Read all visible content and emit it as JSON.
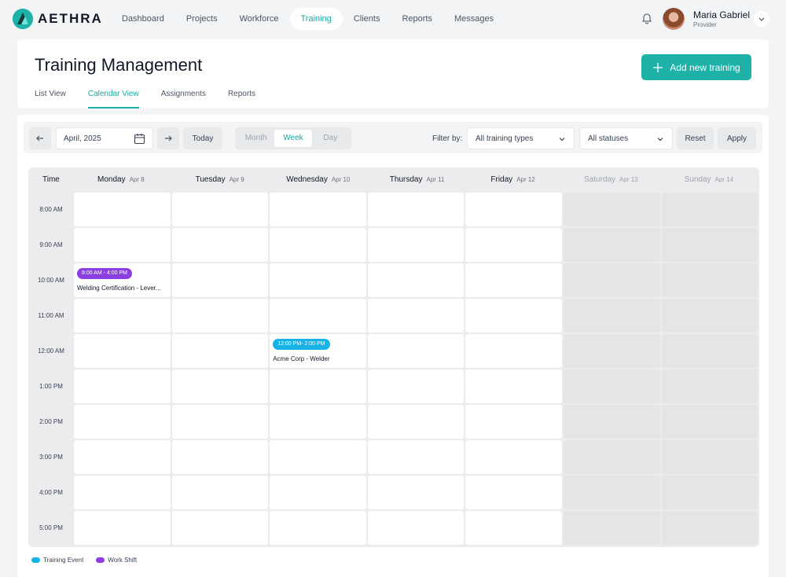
{
  "brand": {
    "name": "AETHRA",
    "accent": "#1db1a7"
  },
  "nav": {
    "items": [
      {
        "label": "Dashboard",
        "active": false
      },
      {
        "label": "Projects",
        "active": false
      },
      {
        "label": "Workforce",
        "active": false
      },
      {
        "label": "Training",
        "active": true
      },
      {
        "label": "Clients",
        "active": false
      },
      {
        "label": "Reports",
        "active": false
      },
      {
        "label": "Messages",
        "active": false
      }
    ],
    "icons": {
      "notifications": "bell-icon",
      "menu": "chevron-down-icon"
    }
  },
  "user": {
    "name": "Maria Gabriel",
    "role": "Provider"
  },
  "header": {
    "title": "Training Management",
    "add_button": "Add new training",
    "tabs": [
      {
        "label": "List View",
        "active": false
      },
      {
        "label": "Calendar View",
        "active": true
      },
      {
        "label": "Assignments",
        "active": false
      },
      {
        "label": "Reports",
        "active": false
      }
    ]
  },
  "toolbar": {
    "date_value": "April, 2025",
    "today": "Today",
    "views": [
      {
        "label": "Month",
        "active": false
      },
      {
        "label": "Week",
        "active": true
      },
      {
        "label": "Day",
        "active": false
      }
    ],
    "filter_label": "Filter by:",
    "type_filter": "All training types",
    "status_filter": "All statuses",
    "reset": "Reset",
    "apply": "Apply"
  },
  "calendar": {
    "time_header": "Time",
    "days": [
      {
        "name": "Monday",
        "date": "Apr 8",
        "weekend": false
      },
      {
        "name": "Tuesday",
        "date": "Apr 9",
        "weekend": false
      },
      {
        "name": "Wednesday",
        "date": "Apr 10",
        "weekend": false
      },
      {
        "name": "Thursday",
        "date": "Apr 11",
        "weekend": false
      },
      {
        "name": "Friday",
        "date": "Apr 12",
        "weekend": false
      },
      {
        "name": "Saturday",
        "date": "Apr 13",
        "weekend": true
      },
      {
        "name": "Sunday",
        "date": "Apr 14",
        "weekend": true
      }
    ],
    "times": [
      "8:00 AM",
      "9:00 AM",
      "10:00 AM",
      "11:00 AM",
      "12:00 AM",
      "1:00 PM",
      "2:00 PM",
      "3:00 PM",
      "4:00 PM",
      "5:00 PM"
    ],
    "events": [
      {
        "day": 0,
        "slot": 2,
        "time": "8:00 AM - 4:00 PM",
        "title": "Welding Certification - Lever...",
        "kind": "Work Shift",
        "color": "#8b3fe0"
      },
      {
        "day": 2,
        "slot": 4,
        "time": "12:00 PM- 2:00 PM",
        "title": "Acme Corp - Welder",
        "kind": "Training Event",
        "color": "#17b3e6"
      }
    ]
  },
  "legend": [
    {
      "label": "Training Event",
      "color": "#17b3e6"
    },
    {
      "label": "Work Shift",
      "color": "#8b3fe0"
    }
  ]
}
